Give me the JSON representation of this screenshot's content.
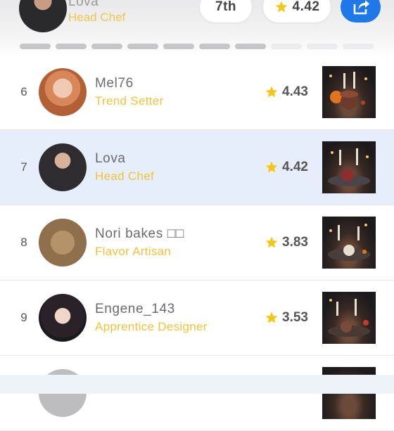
{
  "header": {
    "user_name": "Lova",
    "user_title": "Head Chef",
    "rank_label": "7th",
    "rating": "4.42",
    "share_icon": "share-icon",
    "star_icon": "star-icon"
  },
  "leaderboard": {
    "rows": [
      {
        "rank": "6",
        "name": "Mel76",
        "title": "Trend Setter",
        "score": "4.43",
        "active": false
      },
      {
        "rank": "7",
        "name": "Lova",
        "title": "Head Chef",
        "score": "4.42",
        "active": true
      },
      {
        "rank": "8",
        "name": "Nori bakes □□",
        "title": "Flavor Artisan",
        "score": "3.83",
        "active": false
      },
      {
        "rank": "9",
        "name": "Engene_143",
        "title": "Apprentice Designer",
        "score": "3.53",
        "active": false
      }
    ]
  },
  "colors": {
    "accent": "#1e78e8",
    "title_gold": "#f0c23b",
    "star": "#f5c518",
    "active_row": "#e6eefb"
  }
}
